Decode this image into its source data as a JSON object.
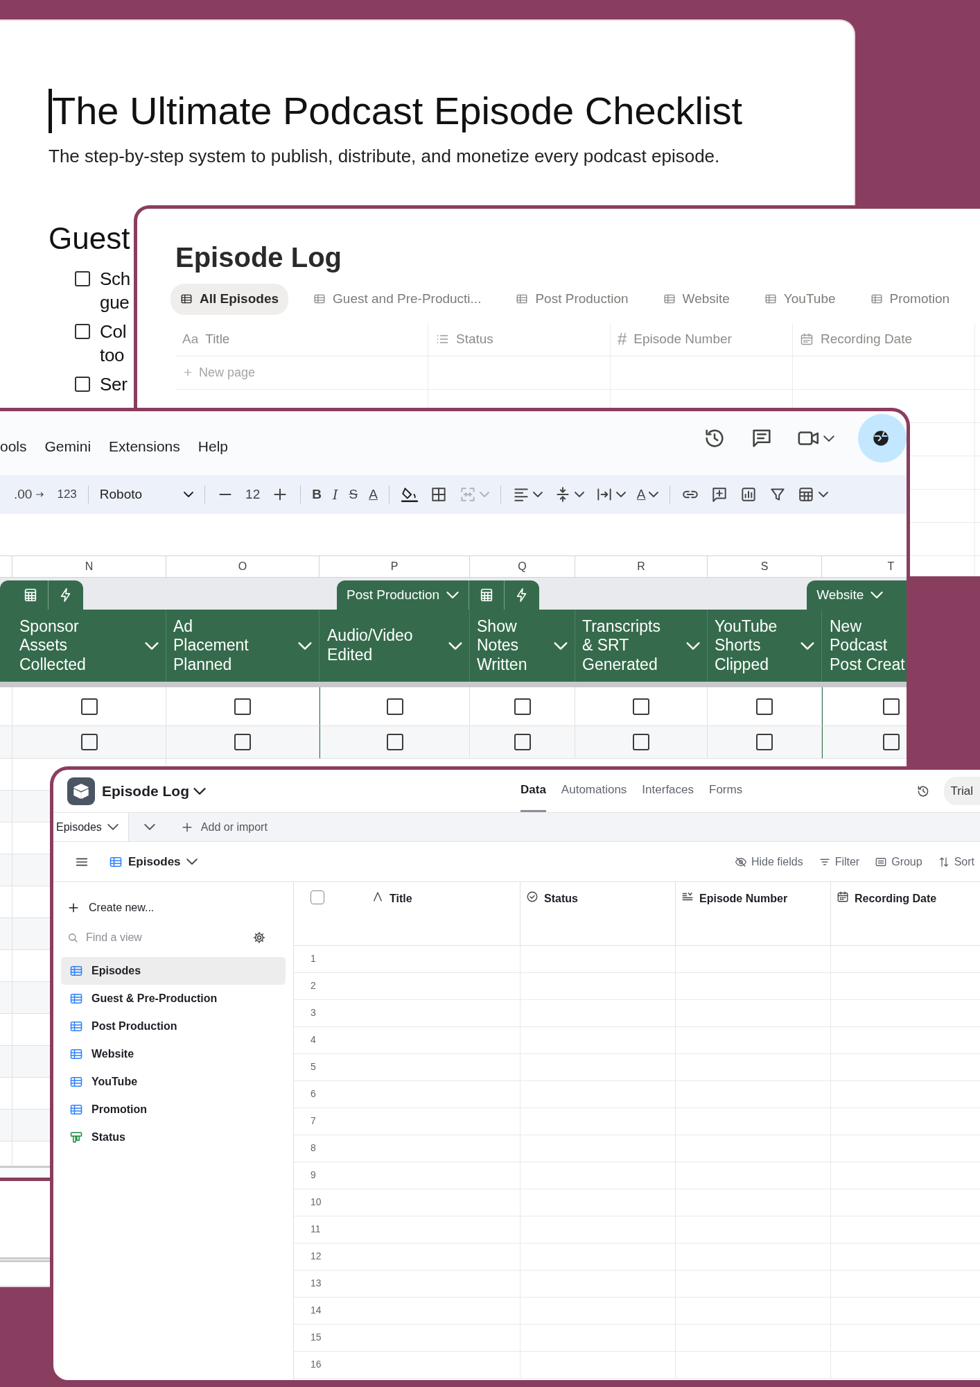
{
  "doc": {
    "title": "The Ultimate Podcast Episode Checklist",
    "subtitle": "The step-by-step system to publish, distribute, and monetize every podcast episode.",
    "section": "Guest",
    "items": [
      {
        "lines": [
          "Sch",
          "gue"
        ],
        "checked": false
      },
      {
        "lines": [
          "Col",
          "too"
        ],
        "checked": false
      },
      {
        "lines": [
          "Ser"
        ],
        "checked": false
      }
    ]
  },
  "notion": {
    "title": "Episode Log",
    "tabs": [
      {
        "label": "All Episodes",
        "selected": true
      },
      {
        "label": "Guest and Pre-Producti...",
        "selected": false
      },
      {
        "label": "Post Production",
        "selected": false
      },
      {
        "label": "Website",
        "selected": false
      },
      {
        "label": "YouTube",
        "selected": false
      },
      {
        "label": "Promotion",
        "selected": false
      }
    ],
    "columns": [
      {
        "label": "Title",
        "kind": "text",
        "glyph": "Aa"
      },
      {
        "label": "Status",
        "kind": "select"
      },
      {
        "label": "Episode Number",
        "kind": "number",
        "glyph": "#"
      },
      {
        "label": "Recording Date",
        "kind": "date"
      }
    ],
    "new_page": "New page"
  },
  "sheets": {
    "menu": [
      "ools",
      "Gemini",
      "Extensions",
      "Help"
    ],
    "toolbar": [
      {
        "kind": "decimal",
        "text": ".00"
      },
      {
        "kind": "plain",
        "text": "123"
      },
      {
        "kind": "divider"
      },
      {
        "kind": "font",
        "text": "Roboto"
      },
      {
        "kind": "divider"
      },
      {
        "kind": "minus"
      },
      {
        "kind": "size",
        "text": "12"
      },
      {
        "kind": "plus"
      },
      {
        "kind": "divider"
      },
      {
        "kind": "bold",
        "text": "B"
      },
      {
        "kind": "italic",
        "text": "I"
      },
      {
        "kind": "strike",
        "text": "S"
      },
      {
        "kind": "color",
        "text": "A"
      },
      {
        "kind": "divider"
      },
      {
        "kind": "fill"
      },
      {
        "kind": "borders"
      },
      {
        "kind": "merge"
      },
      {
        "kind": "divider"
      },
      {
        "kind": "halign"
      },
      {
        "kind": "valign"
      },
      {
        "kind": "wrap"
      },
      {
        "kind": "rotate",
        "text": "A"
      },
      {
        "kind": "divider"
      },
      {
        "kind": "link"
      },
      {
        "kind": "comment"
      },
      {
        "kind": "chart"
      },
      {
        "kind": "filter"
      },
      {
        "kind": "functions"
      }
    ],
    "column_letters": [
      "N",
      "O",
      "P",
      "Q",
      "R",
      "S",
      "T"
    ],
    "groups": [
      {
        "label": "Post Production"
      },
      {
        "label": "Website"
      }
    ],
    "headers": [
      {
        "label": "Sponsor Assets Collected",
        "caret": true
      },
      {
        "label": "Ad Placement Planned",
        "caret": true
      },
      {
        "label": "Audio/Video Edited",
        "caret": true
      },
      {
        "label": "Show Notes Written",
        "caret": true
      },
      {
        "label": "Transcripts & SRT Generated",
        "caret": true
      },
      {
        "label": "YouTube Shorts Clipped",
        "caret": true
      },
      {
        "label": "New Podcast Post Creat",
        "caret": false
      }
    ],
    "rows": [
      {
        "cells": [
          {
            "checked": false
          },
          {
            "checked": false
          },
          {
            "checked": false
          },
          {
            "checked": false
          },
          {
            "checked": false
          },
          {
            "checked": false
          },
          {
            "checked": false
          }
        ]
      },
      {
        "cells": [
          {
            "checked": false
          },
          {
            "checked": false
          },
          {
            "checked": false
          },
          {
            "checked": false
          },
          {
            "checked": false
          },
          {
            "checked": false
          },
          {
            "checked": false
          }
        ]
      }
    ]
  },
  "airtable": {
    "base_name": "Episode Log",
    "nav": [
      {
        "label": "Data",
        "selected": true
      },
      {
        "label": "Automations",
        "selected": false
      },
      {
        "label": "Interfaces",
        "selected": false
      },
      {
        "label": "Forms",
        "selected": false
      }
    ],
    "trial": "Trial",
    "tabs": [
      {
        "label": "Episodes",
        "selected": true
      }
    ],
    "add_import": "Add or import",
    "view_name": "Episodes",
    "toolbar": [
      {
        "label": "Hide fields",
        "kind": "hide"
      },
      {
        "label": "Filter",
        "kind": "filter"
      },
      {
        "label": "Group",
        "kind": "group"
      },
      {
        "label": "Sort",
        "kind": "sort"
      }
    ],
    "create_new": "Create new...",
    "find_placeholder": "Find a view",
    "views": [
      {
        "label": "Episodes",
        "kind": "grid",
        "selected": true
      },
      {
        "label": "Guest & Pre-Production",
        "kind": "grid",
        "selected": false
      },
      {
        "label": "Post Production",
        "kind": "grid",
        "selected": false
      },
      {
        "label": "Website",
        "kind": "grid",
        "selected": false
      },
      {
        "label": "YouTube",
        "kind": "grid",
        "selected": false
      },
      {
        "label": "Promotion",
        "kind": "grid",
        "selected": false
      },
      {
        "label": "Status",
        "kind": "kanban",
        "selected": false
      }
    ],
    "select_all": {
      "checked": false
    },
    "columns": [
      {
        "label": "Title",
        "kind": "text"
      },
      {
        "label": "Status",
        "kind": "select"
      },
      {
        "label": "Episode Number",
        "kind": "number"
      },
      {
        "label": "Recording Date",
        "kind": "date"
      }
    ],
    "row_numbers": [
      "1",
      "2",
      "3",
      "4",
      "5",
      "6",
      "7",
      "8",
      "9",
      "10",
      "11",
      "12",
      "13",
      "14",
      "15",
      "16"
    ]
  }
}
